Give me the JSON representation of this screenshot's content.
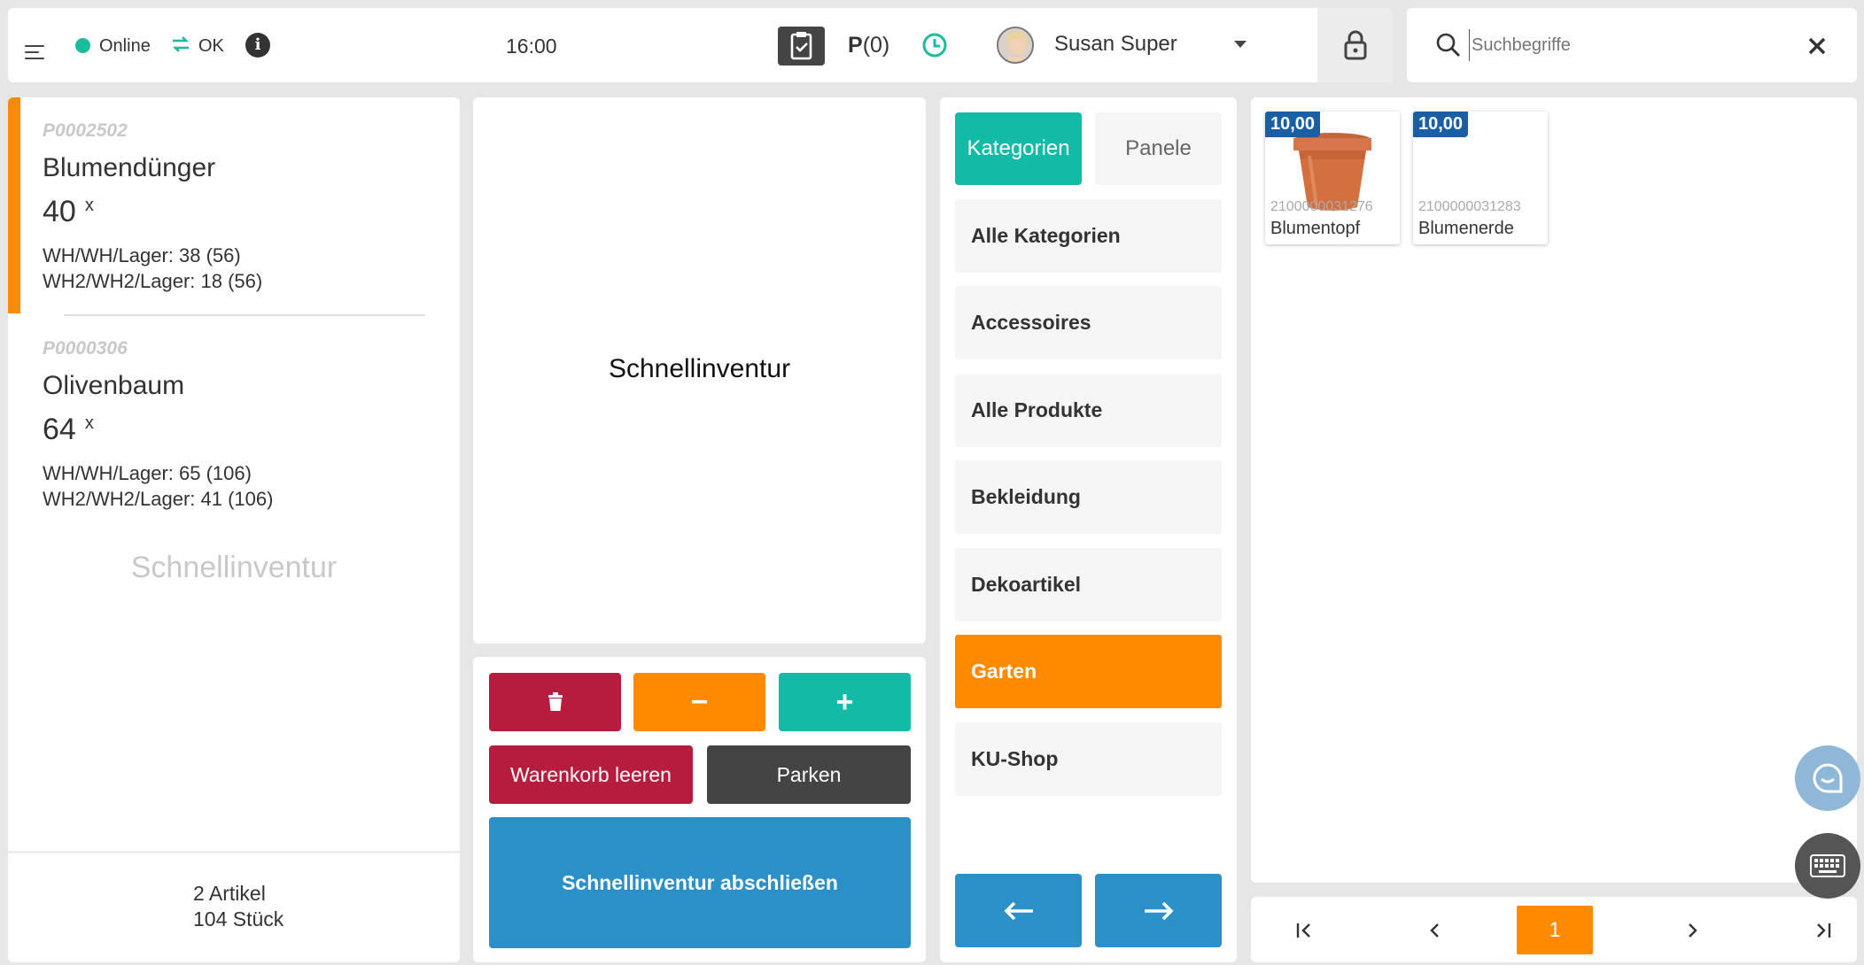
{
  "topbar": {
    "status_online": "Online",
    "status_sync": "OK",
    "time": "16:00",
    "parked": "(0)",
    "parked_prefix": "P",
    "user_name": "Susan Super"
  },
  "search": {
    "placeholder": "Suchbegriffe"
  },
  "cart": {
    "items": [
      {
        "number": "P0002502",
        "name": "Blumendünger",
        "qty": "40",
        "qty_suffix": "x",
        "stock1": "WH/WH/Lager: 38 (56)",
        "stock2": "WH2/WH2/Lager: 18 (56)"
      },
      {
        "number": "P0000306",
        "name": "Olivenbaum",
        "qty": "64",
        "qty_suffix": "x",
        "stock1": "WH/WH/Lager: 65 (106)",
        "stock2": "WH2/WH2/Lager: 41 (106)"
      }
    ],
    "mode_label": "Schnellinventur",
    "summary_articles": "2 Artikel",
    "summary_pieces": "104 Stück"
  },
  "display": {
    "title": "Schnellinventur"
  },
  "actions": {
    "clear_cart": "Warenkorb leeren",
    "park": "Parken",
    "finish": "Schnellinventur abschließen",
    "minus": "−",
    "plus": "+"
  },
  "categories": {
    "tab_categories": "Kategorien",
    "tab_panels": "Panele",
    "items": [
      "Alle Kategorien",
      "Accessoires",
      "Alle Produkte",
      "Bekleidung",
      "Dekoartikel",
      "Garten",
      "KU-Shop"
    ],
    "active": "Garten"
  },
  "products": [
    {
      "price": "10,00",
      "ean": "2100000031276",
      "name": "Blumentopf"
    },
    {
      "price": "10,00",
      "ean": "2100000031283",
      "name": "Blumenerde"
    }
  ],
  "pager": {
    "current": "1"
  },
  "colors": {
    "accent_orange": "#ff8a00",
    "teal": "#1abc9c",
    "red": "#b71c3e",
    "blue": "#2b8fc8",
    "price_blue": "#1a5fa6",
    "dark": "#444444"
  }
}
